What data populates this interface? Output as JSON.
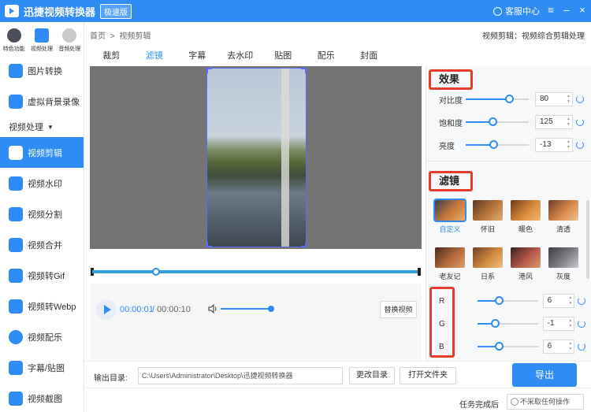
{
  "app": {
    "title": "迅捷视频转换器",
    "badge": "极速版",
    "service": "客服中心"
  },
  "sidebar": {
    "top_tabs": [
      {
        "label": "特色功能",
        "icon": "star-icon"
      },
      {
        "label": "视频处理",
        "icon": "film-icon"
      },
      {
        "label": "音频处理",
        "icon": "music-icon"
      }
    ],
    "items_top": [
      {
        "label": "图片转换",
        "icon": "image-icon"
      },
      {
        "label": "虚拟背景录像",
        "icon": "camera-icon"
      }
    ],
    "group_label": "视频处理",
    "items": [
      {
        "label": "视频剪辑",
        "icon": "film-edit-icon",
        "active": true
      },
      {
        "label": "视频水印",
        "icon": "stamp-icon"
      },
      {
        "label": "视频分割",
        "icon": "split-icon"
      },
      {
        "label": "视频合并",
        "icon": "merge-icon"
      },
      {
        "label": "视频转Gif",
        "icon": "gif-icon"
      },
      {
        "label": "视频转Webp",
        "icon": "webp-icon"
      },
      {
        "label": "视频配乐",
        "icon": "music-note-icon"
      },
      {
        "label": "字幕/贴图",
        "icon": "sticker-icon"
      },
      {
        "label": "视频截图",
        "icon": "screenshot-icon"
      }
    ]
  },
  "breadcrumb": {
    "home": "首页",
    "sep": ">",
    "current": "视频剪辑"
  },
  "page_note": "视频剪辑：视频综合剪辑处理",
  "tabs": [
    "裁剪",
    "滤镜",
    "字幕",
    "去水印",
    "贴图",
    "配乐",
    "封面"
  ],
  "active_tab": 1,
  "player": {
    "current_time": "00:00:01",
    "sep": "/",
    "total_time": "00:00:10",
    "replace_button": "替换视频"
  },
  "panel": {
    "effects_title": "效果",
    "params": [
      {
        "label": "对比度",
        "value": "80"
      },
      {
        "label": "饱和度",
        "value": "125"
      },
      {
        "label": "亮度",
        "value": "-13"
      }
    ],
    "filters_title": "滤镜",
    "filters": [
      {
        "label": "自定义",
        "active": true,
        "color": "#c9783a"
      },
      {
        "label": "怀旧",
        "color": "#b9763b"
      },
      {
        "label": "暖色",
        "color": "#d88a3a"
      },
      {
        "label": "清透",
        "color": "#d9874a"
      },
      {
        "label": "老友记",
        "color": "#b46a3c"
      },
      {
        "label": "日系",
        "color": "#d1883f"
      },
      {
        "label": "港风",
        "color": "#b5584a"
      },
      {
        "label": "灰度",
        "color": "#7e7e86"
      }
    ],
    "rgb": [
      {
        "label": "R",
        "value": "6"
      },
      {
        "label": "G",
        "value": "-1"
      },
      {
        "label": "B",
        "value": "6"
      }
    ]
  },
  "output": {
    "label": "输出目录:",
    "path": "C:\\Users\\Administrator\\Desktop\\迅捷视频转换器",
    "change_button": "更改目录",
    "open_button": "打开文件夹",
    "export_button": "导出"
  },
  "status": {
    "label": "任务完成后",
    "select_value": "不采取任何操作"
  },
  "colors": {
    "accent": "#2f8cf4",
    "highlight_box": "#e53c2b"
  }
}
